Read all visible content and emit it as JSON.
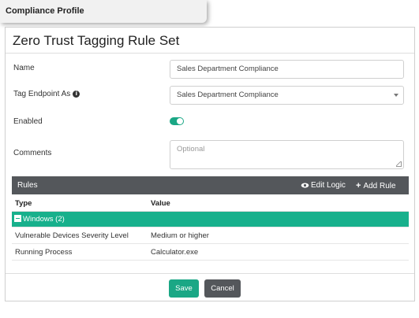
{
  "header": {
    "tab_title": "Compliance Profile"
  },
  "panel": {
    "title": "Zero Trust Tagging Rule Set"
  },
  "form": {
    "name_label": "Name",
    "name_value": "Sales Department Compliance",
    "tag_endpoint_label": "Tag Endpoint As",
    "tag_endpoint_value": "Sales Department Compliance",
    "enabled_label": "Enabled",
    "enabled": true,
    "comments_label": "Comments",
    "comments_placeholder": "Optional"
  },
  "rules": {
    "title": "Rules",
    "edit_logic_label": "Edit Logic",
    "add_rule_label": "Add Rule",
    "columns": [
      "Type",
      "Value"
    ],
    "group_label": "Windows (2)",
    "rows": [
      {
        "type": "Vulnerable Devices Severity Level",
        "value": "Medium or higher"
      },
      {
        "type": "Running Process",
        "value": "Calculator.exe"
      }
    ]
  },
  "footer": {
    "save_label": "Save",
    "cancel_label": "Cancel"
  },
  "colors": {
    "accent": "#1aa785",
    "dark_bar": "#54575b"
  }
}
